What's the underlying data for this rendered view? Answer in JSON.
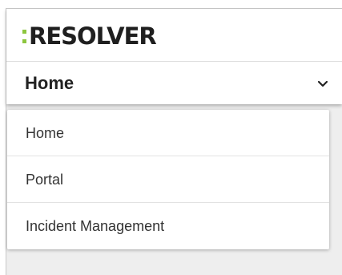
{
  "brand": {
    "logo_text": "RESOLVER",
    "accent_color": "#8dc63f"
  },
  "nav": {
    "current": "Home",
    "toggle_icon": "chevron-down-icon"
  },
  "menu": {
    "items": [
      {
        "label": "Home"
      },
      {
        "label": "Portal"
      },
      {
        "label": "Incident Management"
      }
    ]
  }
}
